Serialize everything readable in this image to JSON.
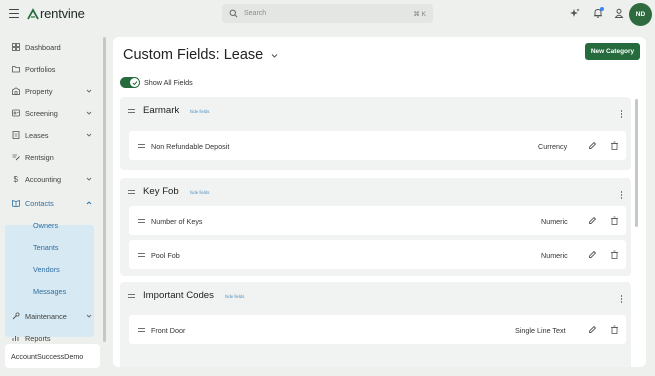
{
  "header": {
    "brand": "rentvine",
    "search_placeholder": "Search",
    "search_shortcut": "⌘ K",
    "icons": [
      "sparkle-icon",
      "bell-icon",
      "user-icon"
    ],
    "avatar_initials": "ND",
    "colors": {
      "brand": "#256b3d",
      "accent_blue": "#3a86ff"
    }
  },
  "sidebar": {
    "items": [
      {
        "label": "Dashboard",
        "icon": "dashboard-icon"
      },
      {
        "label": "Portfolios",
        "icon": "folder-icon"
      },
      {
        "label": "Property",
        "icon": "building-icon"
      },
      {
        "label": "Screening",
        "icon": "screening-icon"
      },
      {
        "label": "Leases",
        "icon": "lease-icon"
      },
      {
        "label": "Rentsign",
        "icon": "signature-icon"
      },
      {
        "label": "Accounting",
        "icon": "dollar-icon"
      },
      {
        "label": "Contacts",
        "icon": "address-book-icon"
      },
      {
        "label": "Maintenance",
        "icon": "wrench-icon"
      },
      {
        "label": "Reports",
        "icon": "chart-icon"
      }
    ],
    "contacts_sub": [
      "Owners",
      "Tenants",
      "Vendors",
      "Messages"
    ],
    "account": "AccountSuccessDemo"
  },
  "main": {
    "title": "Custom Fields: Lease",
    "new_category_label": "New Category",
    "toggle_label": "Show All Fields",
    "hide_fields_label": "hide fields",
    "categories": [
      {
        "name": "Earmark",
        "fields": [
          {
            "name": "Non Refundable Deposit",
            "type": "Currency"
          }
        ]
      },
      {
        "name": "Key Fob",
        "fields": [
          {
            "name": "Number of Keys",
            "type": "Numeric"
          },
          {
            "name": "Pool Fob",
            "type": "Numeric"
          }
        ]
      },
      {
        "name": "Important Codes",
        "fields": [
          {
            "name": "Front Door",
            "type": "Single Line Text"
          }
        ]
      }
    ]
  }
}
